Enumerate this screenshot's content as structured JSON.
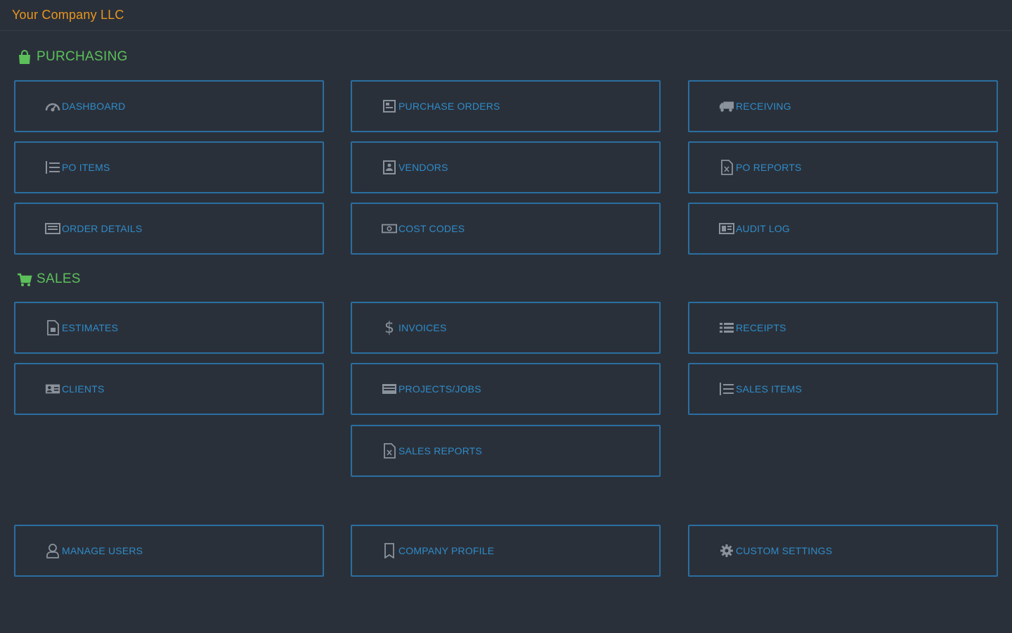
{
  "app": {
    "title": "Your Company LLC"
  },
  "colors": {
    "background": "#2a303a",
    "brand": "#e8961e",
    "section_title": "#5cc05a",
    "tile_border": "#2a6fa0",
    "tile_text": "#2f8cc8",
    "icon": "#8a929c"
  },
  "purchasing": {
    "title": "PURCHASING",
    "icon": "shopping-bag-icon",
    "tiles": [
      {
        "label": "DASHBOARD",
        "icon": "dashboard-icon"
      },
      {
        "label": "PURCHASE ORDERS",
        "icon": "purchase-orders-icon"
      },
      {
        "label": "RECEIVING",
        "icon": "truck-icon"
      },
      {
        "label": "PO ITEMS",
        "icon": "list-icon"
      },
      {
        "label": "VENDORS",
        "icon": "vendor-icon"
      },
      {
        "label": "PO REPORTS",
        "icon": "report-file-icon"
      },
      {
        "label": "ORDER DETAILS",
        "icon": "order-details-icon"
      },
      {
        "label": "COST CODES",
        "icon": "money-icon"
      },
      {
        "label": "AUDIT LOG",
        "icon": "log-icon"
      }
    ]
  },
  "sales": {
    "title": "SALES",
    "icon": "cart-icon",
    "tiles": [
      {
        "label": "ESTIMATES",
        "icon": "estimate-file-icon"
      },
      {
        "label": "INVOICES",
        "icon": "dollar-icon"
      },
      {
        "label": "RECEIPTS",
        "icon": "receipt-list-icon"
      },
      {
        "label": "CLIENTS",
        "icon": "client-card-icon"
      },
      {
        "label": "PROJECTS/JOBS",
        "icon": "projects-icon"
      },
      {
        "label": "SALES ITEMS",
        "icon": "list-icon"
      },
      {
        "label": "SALES REPORTS",
        "icon": "report-file-icon"
      }
    ]
  },
  "admin": {
    "tiles": [
      {
        "label": "MANAGE USERS",
        "icon": "user-icon"
      },
      {
        "label": "COMPANY PROFILE",
        "icon": "bookmark-icon"
      },
      {
        "label": "CUSTOM SETTINGS",
        "icon": "gear-icon"
      }
    ]
  }
}
